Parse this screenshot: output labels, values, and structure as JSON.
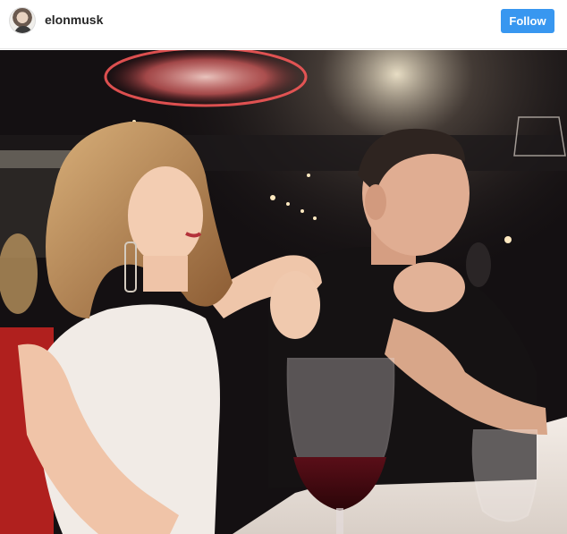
{
  "post": {
    "username": "elonmusk",
    "follow_label": "Follow",
    "avatar_icon": "profile-avatar",
    "accent_color": "#3897f0"
  }
}
